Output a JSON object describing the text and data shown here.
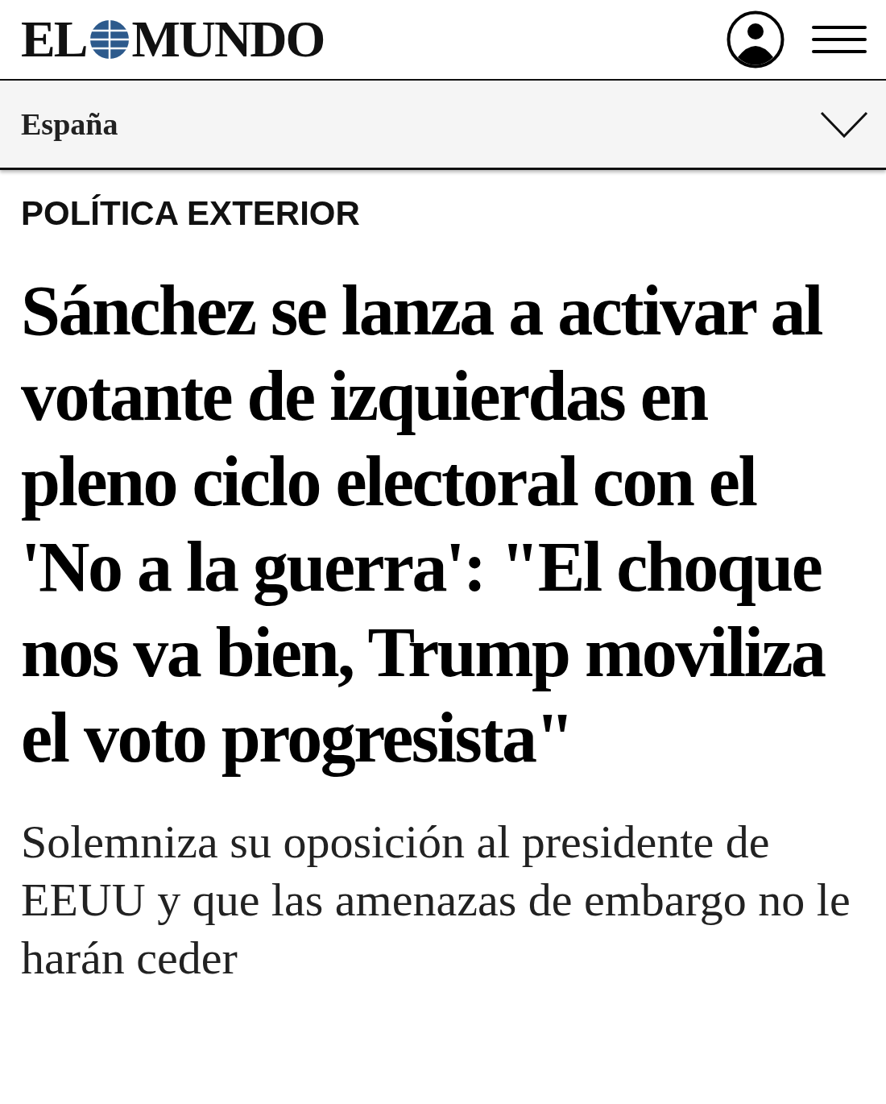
{
  "header": {
    "logo": {
      "left": "EL",
      "right": "MUNDO"
    }
  },
  "section_bar": {
    "label": "España",
    "expanded": false
  },
  "article": {
    "category": "POLÍTICA EXTERIOR",
    "headline": "Sánchez se lanza a activar al votante de izquierdas en pleno ciclo electoral con el 'No a la guerra': \"El choque nos va bien, Trump moviliza el voto progresista\"",
    "subtitle": "Solemniza su oposición al presidente de EEUU y que las amenazas de embargo no le harán ceder"
  }
}
